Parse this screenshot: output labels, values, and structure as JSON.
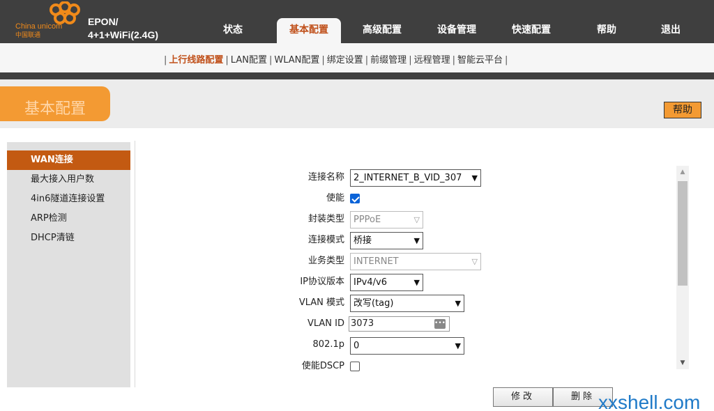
{
  "header": {
    "logo": {
      "en": "China unicom",
      "cn": "中国联通"
    },
    "product_line1": "EPON/",
    "product_line2": "4+1+WiFi(2.4G)",
    "nav": [
      {
        "label": "状态",
        "active": false
      },
      {
        "label": "基本配置",
        "active": true
      },
      {
        "label": "高级配置",
        "active": false
      },
      {
        "label": "设备管理",
        "active": false
      },
      {
        "label": "快速配置",
        "active": false
      },
      {
        "label": "帮助",
        "active": false
      },
      {
        "label": "退出",
        "active": false
      }
    ]
  },
  "subnav": {
    "items": [
      "上行线路配置",
      "LAN配置",
      "WLAN配置",
      "绑定设置",
      "前缀管理",
      "远程管理",
      "智能云平台"
    ],
    "active_index": 0
  },
  "page": {
    "title": "基本配置",
    "help_label": "帮助"
  },
  "sidebar": {
    "items": [
      "WAN连接",
      "最大接入用户数",
      "4in6隧道连接设置",
      "ARP检测",
      "DHCP清链"
    ],
    "active_index": 0
  },
  "form": {
    "connection_name": {
      "label": "连接名称",
      "value": "2_INTERNET_B_VID_307"
    },
    "enable": {
      "label": "使能",
      "checked": true
    },
    "encap_type": {
      "label": "封装类型",
      "value": "PPPoE",
      "disabled": true
    },
    "conn_mode": {
      "label": "连接模式",
      "value": "桥接"
    },
    "service_type": {
      "label": "业务类型",
      "value": "INTERNET",
      "disabled": true
    },
    "ip_version": {
      "label": "IP协议版本",
      "value": "IPv4/v6"
    },
    "vlan_mode": {
      "label": "VLAN 模式",
      "value": "改写(tag)"
    },
    "vlan_id": {
      "label": "VLAN ID",
      "value": "3073"
    },
    "dot1p": {
      "label": "802.1p",
      "value": "0"
    },
    "dscp": {
      "label": "使能DSCP",
      "checked": false
    }
  },
  "buttons": {
    "modify": "修改",
    "delete": "删除"
  },
  "watermark": "xxshell.com",
  "colors": {
    "accent": "#c0501a",
    "orange": "#f39a33",
    "header_bg": "#3f3f3f",
    "link_blue": "#0a63d8"
  }
}
